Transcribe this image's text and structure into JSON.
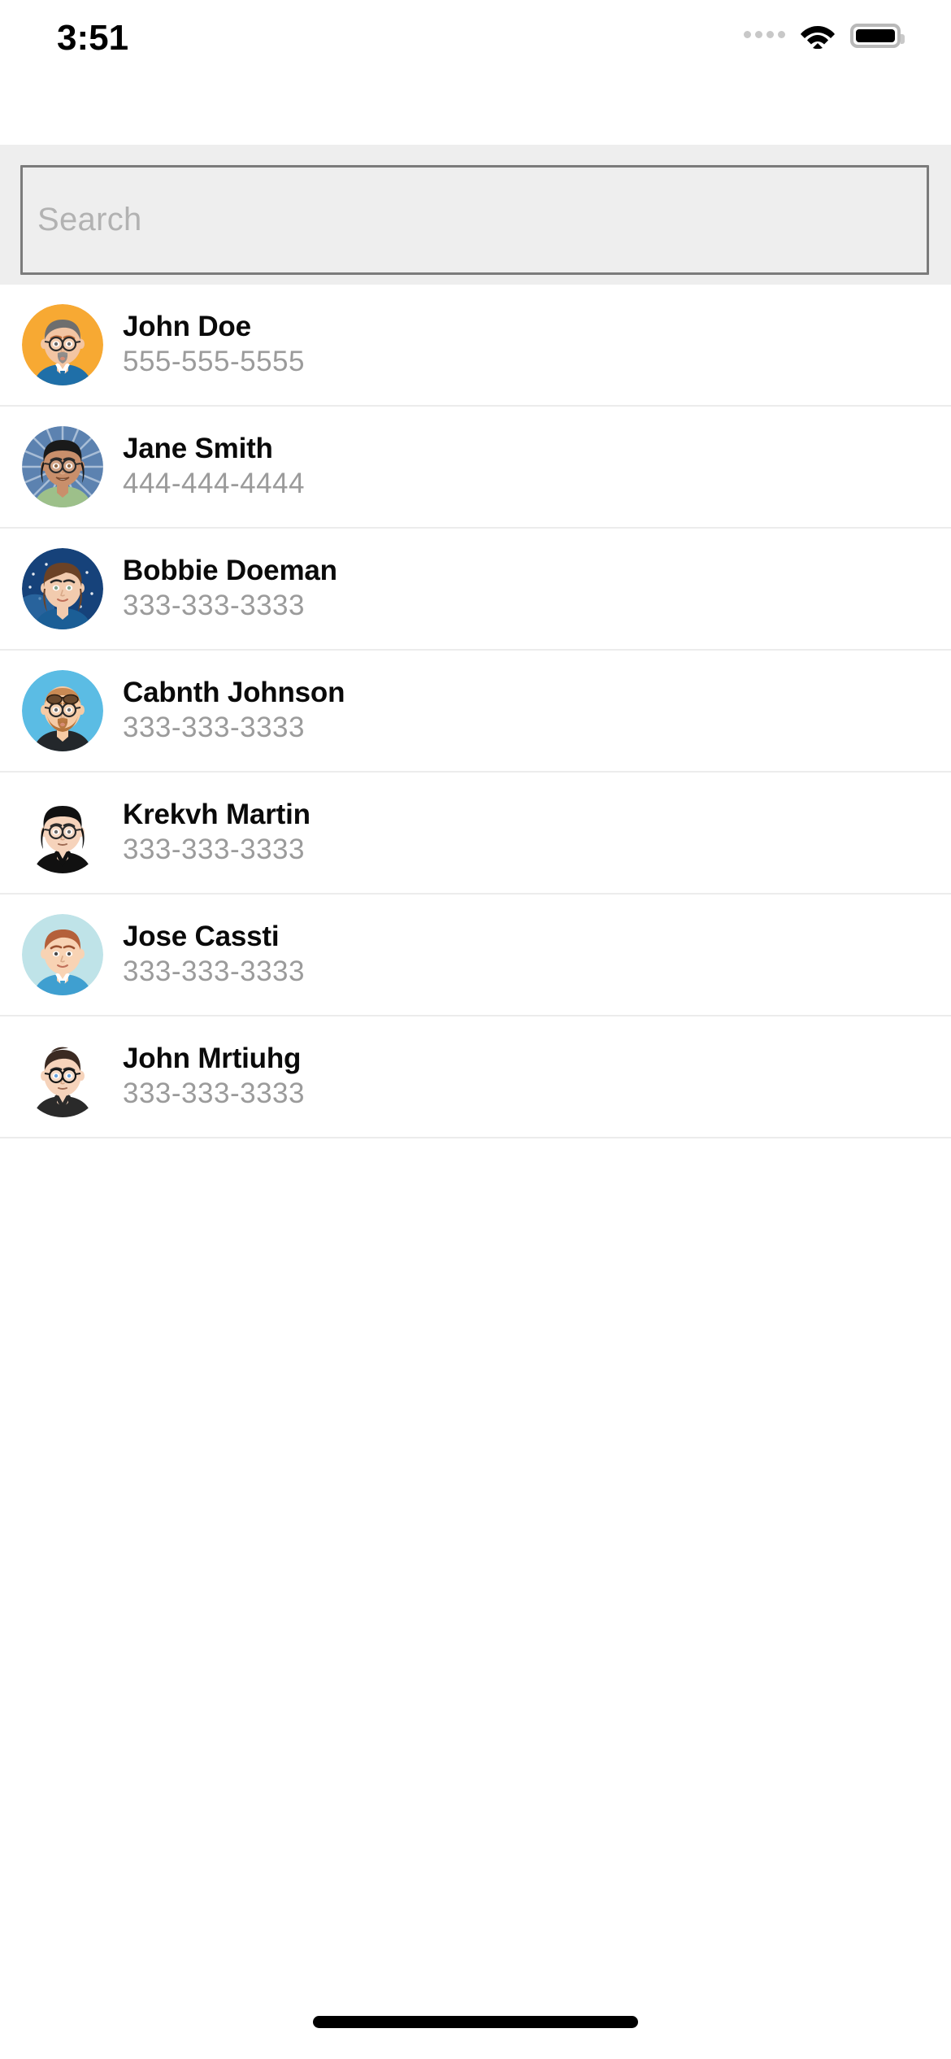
{
  "status_bar": {
    "time": "3:51",
    "signal_icon": "signal-dots-icon",
    "wifi_icon": "wifi-icon",
    "battery_icon": "battery-full-icon"
  },
  "search": {
    "placeholder": "Search",
    "value": "",
    "name": "search-input"
  },
  "contacts": [
    {
      "name": "John Doe",
      "phone": "555-555-5555",
      "avatar": {
        "bg": "#F7A933",
        "skin": "#F3C5A3",
        "hair": "#6E6E6E",
        "shirt": "#1F6FA8",
        "glasses": true,
        "beard": "#8A8A8A"
      }
    },
    {
      "name": "Jane Smith",
      "phone": "444-444-4444",
      "avatar": {
        "bg": "#5C82B0",
        "skin": "#C98F6B",
        "hair": "#1A1A1A",
        "shirt": "#9DC08A",
        "glasses": true,
        "beard": ""
      }
    },
    {
      "name": "Bobbie Doeman",
      "phone": "333-333-3333",
      "avatar": {
        "bg": "#16427A",
        "skin": "#F2CBAE",
        "hair": "#6B4226",
        "shirt": "#1B5E96",
        "glasses": false,
        "beard": ""
      }
    },
    {
      "name": "Cabnth Johnson",
      "phone": "333-333-3333",
      "avatar": {
        "bg": "#5BBCE4",
        "skin": "#F6CBA5",
        "hair": "#C98A54",
        "shirt": "#23272B",
        "glasses": true,
        "beard": "#B5743C"
      }
    },
    {
      "name": "Krekvh Martin",
      "phone": "333-333-3333",
      "avatar": {
        "bg": "#FFFFFF",
        "skin": "#F6D3BB",
        "hair": "#111111",
        "shirt": "#111111",
        "glasses": true,
        "beard": ""
      }
    },
    {
      "name": "Jose Cassti",
      "phone": "333-333-3333",
      "avatar": {
        "bg": "#BFE3E8",
        "skin": "#F8D3B4",
        "hair": "#B4603A",
        "shirt": "#3F9FD0",
        "glasses": false,
        "beard": ""
      }
    },
    {
      "name": "John Mrtiuhg",
      "phone": "333-333-3333",
      "avatar": {
        "bg": "#FFFFFF",
        "skin": "#F6D3BB",
        "hair": "#3B2A22",
        "shirt": "#2A2A2A",
        "glasses": true,
        "beard": ""
      }
    }
  ],
  "home_indicator": {
    "name": "home-indicator"
  }
}
